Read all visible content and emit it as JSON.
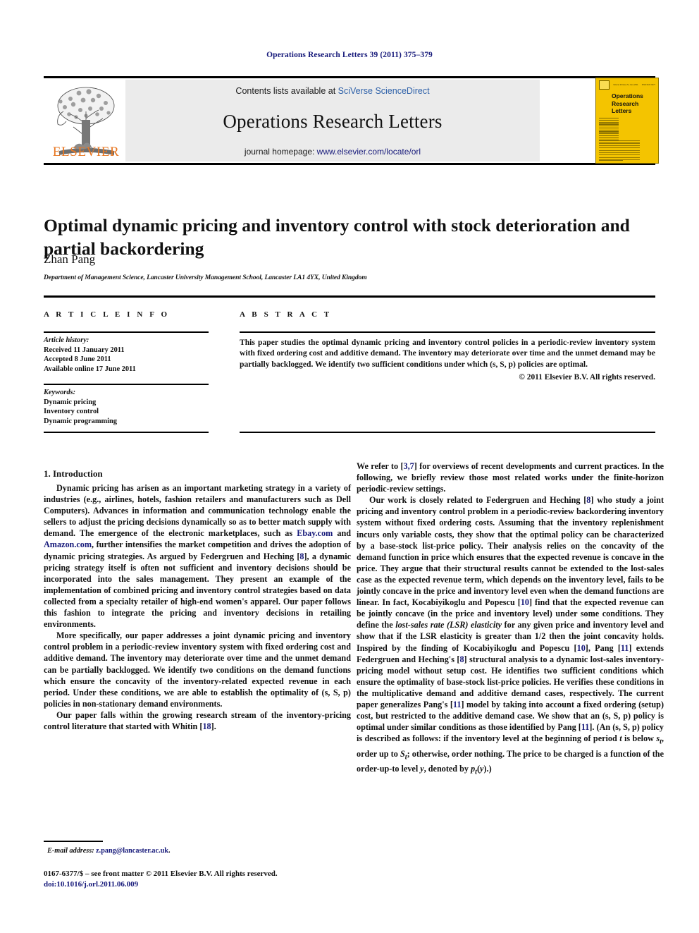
{
  "running_head": "Operations Research Letters 39 (2011) 375–379",
  "masthead": {
    "contents_prefix": "Contents lists available at ",
    "contents_link": "SciVerse ScienceDirect",
    "journal_name": "Operations Research Letters",
    "homepage_prefix": "journal homepage: ",
    "homepage_link": "www.elsevier.com/locate/orl",
    "publisher_wordmark": "ELSEVIER",
    "cover": {
      "title_line1": "Operations",
      "title_line2": "Research",
      "title_line3": "Letters",
      "volume_text": "Volume 39 Issue 5 | June 2011",
      "issn_text": "ISSN 0167-6377"
    },
    "accent_orange": "#e87722",
    "link_blue": "#2b5fa8",
    "cover_yellow": "#f4c400",
    "band_gray": "#ebebeb"
  },
  "article": {
    "title": "Optimal dynamic pricing and inventory control with stock deterioration and partial backordering",
    "author": "Zhan Pang",
    "affiliation": "Department of Management Science, Lancaster University Management School, Lancaster LA1 4YX, United Kingdom"
  },
  "info": {
    "heading": "A R T I C L E   I N F O",
    "history_label": "Article history:",
    "history": [
      "Received 11 January 2011",
      "Accepted 8 June 2011",
      "Available online 17 June 2011"
    ],
    "keywords_label": "Keywords:",
    "keywords": [
      "Dynamic pricing",
      "Inventory control",
      "Dynamic programming"
    ]
  },
  "abstract": {
    "heading": "A B S T R A C T",
    "text": "This paper studies the optimal dynamic pricing and inventory control policies in a periodic-review inventory system with fixed ordering cost and additive demand. The inventory may deteriorate over time and the unmet demand may be partially backlogged. We identify two sufficient conditions under which (s, S, p) policies are optimal.",
    "copyright": "© 2011 Elsevier B.V. All rights reserved."
  },
  "body": {
    "section_title": "1. Introduction",
    "left_paragraphs": [
      {
        "segments": [
          {
            "t": "Dynamic pricing has arisen as an important marketing strategy in a variety of industries (e.g., airlines, hotels, fashion retailers and manufacturers such as Dell Computers). Advances in information and communication technology enable the sellers to adjust the pricing decisions dynamically so as to better match supply with demand. The emergence of the electronic marketplaces, such as "
          },
          {
            "t": "Ebay.com",
            "k": "link"
          },
          {
            "t": " and "
          },
          {
            "t": "Amazon.com",
            "k": "link"
          },
          {
            "t": ", further intensifies the market competition and drives the adoption of dynamic pricing strategies. As argued by Federgruen and Heching ["
          },
          {
            "t": "8",
            "k": "ref"
          },
          {
            "t": "], a dynamic pricing strategy itself is often not sufficient and inventory decisions should be incorporated into the sales management. They present an example of the implementation of combined pricing and inventory control strategies based on data collected from a specialty retailer of high-end women's apparel. Our paper follows this fashion to integrate the pricing and inventory decisions in retailing environments."
          }
        ]
      },
      {
        "segments": [
          {
            "t": "More specifically, our paper addresses a joint dynamic pricing and inventory control problem in a periodic-review inventory system with fixed ordering cost and additive demand. The inventory may deteriorate over time and the unmet demand can be partially backlogged. We identify two conditions on the demand functions which ensure the concavity of the inventory-related expected revenue in each period. Under these conditions, we are able to establish the optimality of (s, S, p) policies in non-stationary demand environments."
          }
        ]
      },
      {
        "segments": [
          {
            "t": "Our paper falls within the growing research stream of the inventory-pricing control literature that started with Whitin ["
          },
          {
            "t": "18",
            "k": "ref"
          },
          {
            "t": "]."
          }
        ]
      }
    ],
    "right_paragraphs": [
      {
        "indent": false,
        "segments": [
          {
            "t": "We refer to ["
          },
          {
            "t": "3,7",
            "k": "ref"
          },
          {
            "t": "] for overviews of recent developments and current practices. In the following, we briefly review those most related works under the finite-horizon periodic-review settings."
          }
        ]
      },
      {
        "indent": true,
        "segments": [
          {
            "t": "Our work is closely related to Federgruen and Heching ["
          },
          {
            "t": "8",
            "k": "ref"
          },
          {
            "t": "] who study a joint pricing and inventory control problem in a periodic-review backordering inventory system without fixed ordering costs. Assuming that the inventory replenishment incurs only variable costs, they show that the optimal policy can be characterized by a base-stock list-price policy. Their analysis relies on the concavity of the demand function in price which ensures that the expected revenue is concave in the price. They argue that their structural results cannot be extended to the lost-sales case as the expected revenue term, which depends on the inventory level, fails to be jointly concave in the price and inventory level even when the demand functions are linear. In fact, Kocabiyikoglu and Popescu ["
          },
          {
            "t": "10",
            "k": "ref"
          },
          {
            "t": "] find that the expected revenue can be jointly concave (in the price and inventory level) under some conditions. They define the "
          },
          {
            "t": "lost-sales rate (LSR) elasticity",
            "k": "ital"
          },
          {
            "t": " for any given price and inventory level and show that if the LSR elasticity is greater than 1/2 then the joint concavity holds. Inspired by the finding of Kocabiyikoglu and Popescu ["
          },
          {
            "t": "10",
            "k": "ref"
          },
          {
            "t": "], Pang ["
          },
          {
            "t": "11",
            "k": "ref"
          },
          {
            "t": "] extends Federgruen and Heching's ["
          },
          {
            "t": "8",
            "k": "ref"
          },
          {
            "t": "] structural analysis to a dynamic lost-sales inventory-pricing model without setup cost. He identifies two sufficient conditions which ensure the optimality of base-stock list-price policies. He verifies these conditions in the multiplicative demand and additive demand cases, respectively. The current paper generalizes Pang's ["
          },
          {
            "t": "11",
            "k": "ref"
          },
          {
            "t": "] model by taking into account a fixed ordering (setup) cost, but restricted to the additive demand case. We show that an (s, S, p) policy is optimal under similar conditions as those identified by Pang ["
          },
          {
            "t": "11",
            "k": "ref"
          },
          {
            "t": "]. (An (s, S, p) policy is described as follows: if the inventory level at the beginning of period "
          },
          {
            "t": "t",
            "k": "ital"
          },
          {
            "t": " is below "
          },
          {
            "t": "s",
            "k": "ital"
          },
          {
            "t": "t",
            "k": "sub-ital"
          },
          {
            "t": ", order up to "
          },
          {
            "t": "S",
            "k": "ital"
          },
          {
            "t": "t",
            "k": "sub-ital"
          },
          {
            "t": "; otherwise, order nothing. The price to be charged is a function of the order-up-to level "
          },
          {
            "t": "y",
            "k": "ital"
          },
          {
            "t": ", denoted by "
          },
          {
            "t": "p",
            "k": "ital"
          },
          {
            "t": "t",
            "k": "sub-ital"
          },
          {
            "t": "("
          },
          {
            "t": "y",
            "k": "ital"
          },
          {
            "t": ").)"
          }
        ]
      }
    ]
  },
  "footer": {
    "email_label": "E-mail address:",
    "email": "z.pang@lancaster.ac.uk",
    "email_suffix": ".",
    "imprint_line1": "0167-6377/$ – see front matter © 2011 Elsevier B.V. All rights reserved.",
    "doi": "doi:10.1016/j.orl.2011.06.009"
  }
}
